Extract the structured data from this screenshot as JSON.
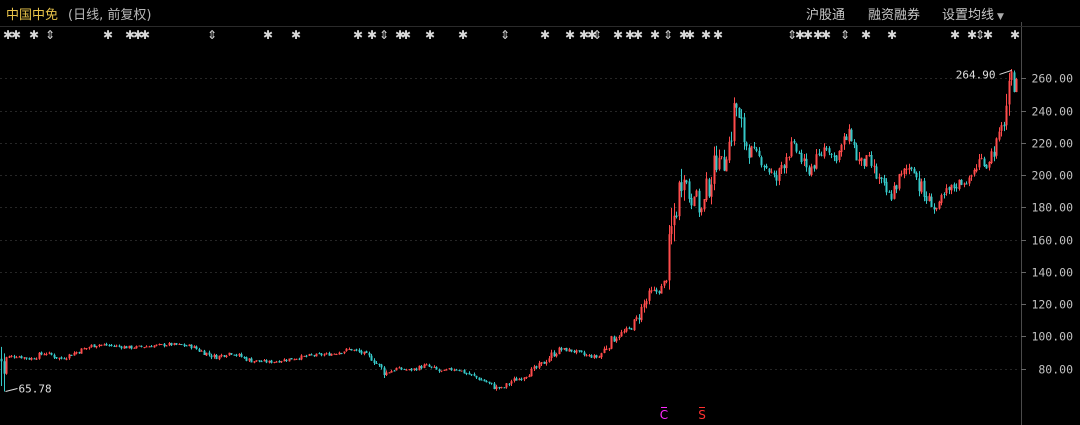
{
  "header": {
    "title": "中国中免",
    "subtitle": "(日线, 前复权)",
    "buttons": {
      "hgt": "沪股通",
      "rzrq": "融资融券",
      "ma": "设置均线"
    },
    "ma_arrow": "▼"
  },
  "event_markers": {
    "row_symbols": [
      "✱",
      "⇕"
    ],
    "bottom_markers": [
      "C",
      "S"
    ]
  },
  "colors": {
    "up": "#ff4b4b",
    "down": "#35c8c8",
    "grid": "#262626",
    "axis_text": "#c0c0c0",
    "marker": "#d8d8d8",
    "c_marker": "#ff2aff",
    "s_marker": "#ff3030",
    "background": "#000000"
  },
  "chart_data": {
    "type": "candlestick",
    "y_ticks": [
      "260.00",
      "240.00",
      "220.00",
      "200.00",
      "180.00",
      "160.00",
      "140.00",
      "120.00",
      "100.00",
      "80.00"
    ],
    "ylim": [
      58,
      272
    ],
    "low_label": "65.78",
    "high_label": "264.90",
    "min_low": 65.78,
    "max_high": 264.9,
    "anchors": [
      [
        0,
        86
      ],
      [
        15,
        88
      ],
      [
        30,
        86
      ],
      [
        45,
        90
      ],
      [
        60,
        86
      ],
      [
        75,
        90
      ],
      [
        95,
        95
      ],
      [
        115,
        94
      ],
      [
        130,
        93
      ],
      [
        150,
        94
      ],
      [
        170,
        95
      ],
      [
        190,
        94
      ],
      [
        200,
        91
      ],
      [
        215,
        87
      ],
      [
        230,
        90
      ],
      [
        250,
        85
      ],
      [
        270,
        84
      ],
      [
        290,
        86
      ],
      [
        310,
        88
      ],
      [
        330,
        89
      ],
      [
        350,
        92
      ],
      [
        360,
        90
      ],
      [
        372,
        86
      ],
      [
        385,
        77
      ],
      [
        395,
        80
      ],
      [
        410,
        79
      ],
      [
        425,
        82
      ],
      [
        440,
        78
      ],
      [
        455,
        80
      ],
      [
        470,
        76
      ],
      [
        485,
        72
      ],
      [
        495,
        68
      ],
      [
        503,
        68
      ],
      [
        510,
        72
      ],
      [
        520,
        74
      ],
      [
        530,
        78
      ],
      [
        540,
        82
      ],
      [
        550,
        88
      ],
      [
        560,
        92
      ],
      [
        572,
        91
      ],
      [
        585,
        88
      ],
      [
        598,
        87
      ],
      [
        605,
        93
      ],
      [
        615,
        100
      ],
      [
        628,
        104
      ],
      [
        636,
        110
      ],
      [
        642,
        118
      ],
      [
        650,
        126
      ],
      [
        660,
        129
      ],
      [
        665,
        134
      ],
      [
        668,
        150
      ],
      [
        672,
        168
      ],
      [
        676,
        182
      ],
      [
        680,
        196
      ],
      [
        683,
        212
      ],
      [
        686,
        195
      ],
      [
        690,
        186
      ],
      [
        695,
        191
      ],
      [
        700,
        175
      ],
      [
        705,
        188
      ],
      [
        710,
        196
      ],
      [
        715,
        208
      ],
      [
        718,
        222
      ],
      [
        722,
        205
      ],
      [
        727,
        214
      ],
      [
        731,
        228
      ],
      [
        735,
        245
      ],
      [
        740,
        230
      ],
      [
        745,
        220
      ],
      [
        750,
        215
      ],
      [
        760,
        210
      ],
      [
        770,
        202
      ],
      [
        775,
        195
      ],
      [
        780,
        205
      ],
      [
        785,
        212
      ],
      [
        792,
        218
      ],
      [
        800,
        212
      ],
      [
        805,
        200
      ],
      [
        812,
        206
      ],
      [
        820,
        212
      ],
      [
        826,
        220
      ],
      [
        830,
        213
      ],
      [
        835,
        210
      ],
      [
        840,
        216
      ],
      [
        845,
        222
      ],
      [
        850,
        225
      ],
      [
        855,
        214
      ],
      [
        860,
        205
      ],
      [
        868,
        210
      ],
      [
        875,
        200
      ],
      [
        880,
        195
      ],
      [
        885,
        190
      ],
      [
        890,
        185
      ],
      [
        895,
        195
      ],
      [
        900,
        198
      ],
      [
        905,
        203
      ],
      [
        912,
        206
      ],
      [
        918,
        195
      ],
      [
        924,
        186
      ],
      [
        930,
        184
      ],
      [
        935,
        178
      ],
      [
        940,
        183
      ],
      [
        945,
        188
      ],
      [
        952,
        192
      ],
      [
        960,
        196
      ],
      [
        968,
        196
      ],
      [
        975,
        205
      ],
      [
        980,
        210
      ],
      [
        986,
        206
      ],
      [
        990,
        212
      ],
      [
        995,
        218
      ],
      [
        1000,
        224
      ],
      [
        1004,
        238
      ],
      [
        1008,
        248
      ],
      [
        1012,
        258
      ],
      [
        1016,
        262
      ]
    ]
  }
}
